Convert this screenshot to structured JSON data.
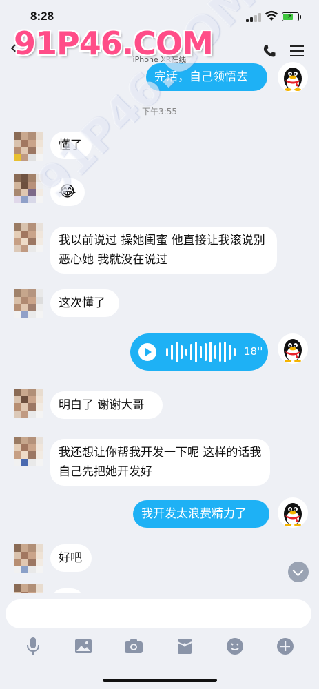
{
  "status": {
    "time": "8:28"
  },
  "header": {
    "title": "",
    "subtitle": "iPhone XR在线"
  },
  "watermark": {
    "main": "91P46.COM",
    "diagonal": "91P46.COM"
  },
  "colors": {
    "bubble_out": "#1eb1f5",
    "bubble_in": "#ffffff",
    "background": "#eef0f5",
    "watermark": "#ff4d88"
  },
  "messages": [
    {
      "side": "out",
      "text": "完活，自己领悟去"
    },
    {
      "type": "timestamp",
      "text": "下午3:55"
    },
    {
      "side": "in",
      "text": "懂了"
    },
    {
      "side": "in",
      "text": "😂"
    },
    {
      "side": "in",
      "text": "我以前说过 操她闺蜜 他直接让我滚说别恶心她 我就没在说过"
    },
    {
      "side": "in",
      "text": "这次懂了"
    },
    {
      "side": "out",
      "type": "voice",
      "duration": "18''"
    },
    {
      "side": "in",
      "text": "明白了 谢谢大哥"
    },
    {
      "side": "in",
      "text": "我还想让你帮我开发一下呢 这样的话我自己先把她开发好"
    },
    {
      "side": "out",
      "text": "我开发太浪费精力了"
    },
    {
      "side": "in",
      "text": "好吧"
    }
  ],
  "input": {
    "placeholder": ""
  },
  "toolbar": [
    "microphone-icon",
    "image-icon",
    "camera-icon",
    "red-packet-icon",
    "emoji-icon",
    "plus-icon"
  ]
}
